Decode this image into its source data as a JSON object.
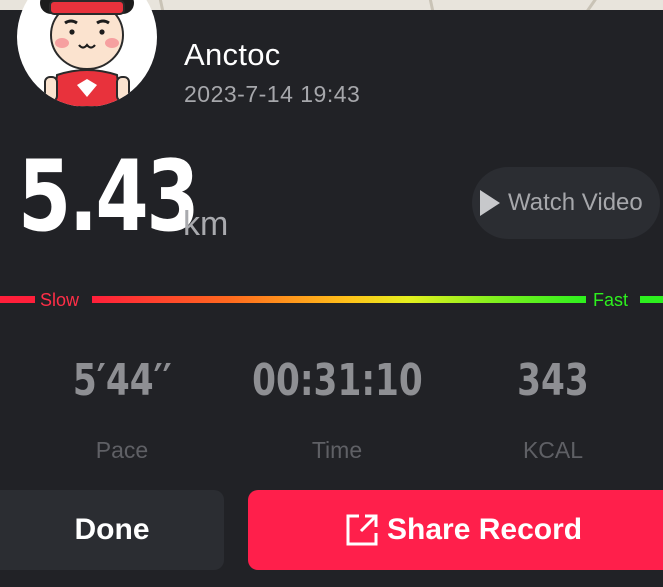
{
  "header": {
    "username": "Anctoc",
    "datetime": "2023-7-14 19:43",
    "avatar_icon": "runner-avatar"
  },
  "summary": {
    "distance": "5.43",
    "unit": "km",
    "watch_video_label": "Watch Video"
  },
  "speed_legend": {
    "slow_label": "Slow",
    "fast_label": "Fast",
    "slow_color": "#ff1f3a",
    "fast_color": "#2df01e"
  },
  "stats": [
    {
      "value": "5′44′′",
      "label": "Pace"
    },
    {
      "value": "00:31:10",
      "label": "Time"
    },
    {
      "value": "343",
      "label": "KCAL"
    }
  ],
  "actions": {
    "done_label": "Done",
    "share_label": "Share Record",
    "share_color": "#ff1f4b"
  }
}
